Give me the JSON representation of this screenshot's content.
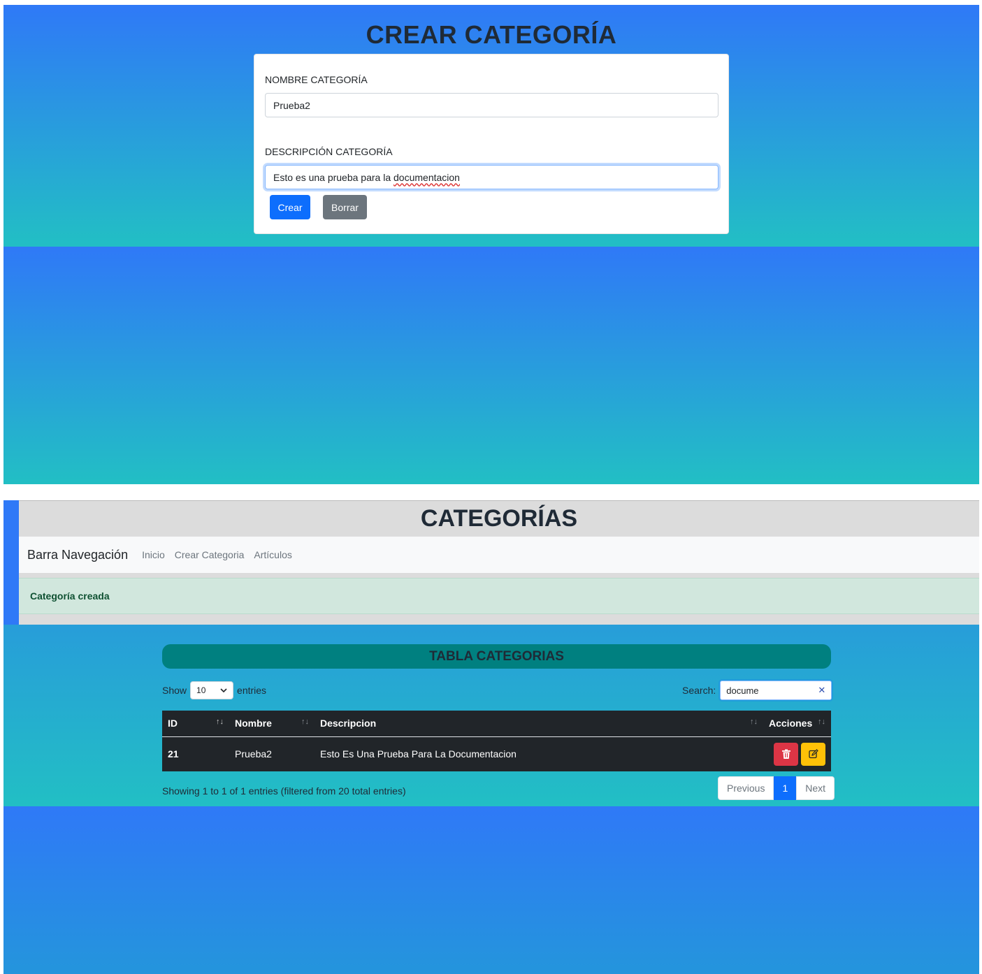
{
  "crear": {
    "title": "CREAR CATEGORÍA",
    "nombre_label": "NOMBRE CATEGORÍA",
    "nombre_value": "Prueba2",
    "descripcion_label": "DESCRIPCIÓN CATEGORÍA",
    "descripcion_value_prefix": "Esto es una prueba para la ",
    "descripcion_value_misspelled": "documentacion",
    "crear_button": "Crear",
    "borrar_button": "Borrar"
  },
  "categorias": {
    "title": "CATEGORÍAS",
    "nav": {
      "brand": "Barra Navegación",
      "links": [
        "Inicio",
        "Crear Categoria",
        "Artículos"
      ]
    },
    "alert": "Categoría creada",
    "table_title": "TABLA CATEGORIAS",
    "length": {
      "prefix": "Show",
      "value": "10",
      "suffix": "entries"
    },
    "search": {
      "label": "Search:",
      "value": "docume"
    },
    "columns": [
      "ID",
      "Nombre",
      "Descripcion",
      "Acciones"
    ],
    "rows": [
      {
        "id": "21",
        "nombre": "Prueba2",
        "descripcion": "Esto Es Una Prueba Para La Documentacion"
      }
    ],
    "info": "Showing 1 to 1 of 1 entries (filtered from 20 total entries)",
    "pagination": {
      "previous": "Previous",
      "current": "1",
      "next": "Next"
    }
  },
  "colors": {
    "gradient_top": "#2f79f7",
    "gradient_bottom": "#22bfc4",
    "primary": "#0d6efd",
    "secondary": "#6c757d",
    "danger": "#dc3545",
    "warning": "#ffc107",
    "teal": "#008080",
    "success_bg": "#d1e7dd"
  },
  "icons": [
    "trash-icon",
    "edit-icon",
    "chevron-down-icon",
    "clear-search-icon"
  ]
}
